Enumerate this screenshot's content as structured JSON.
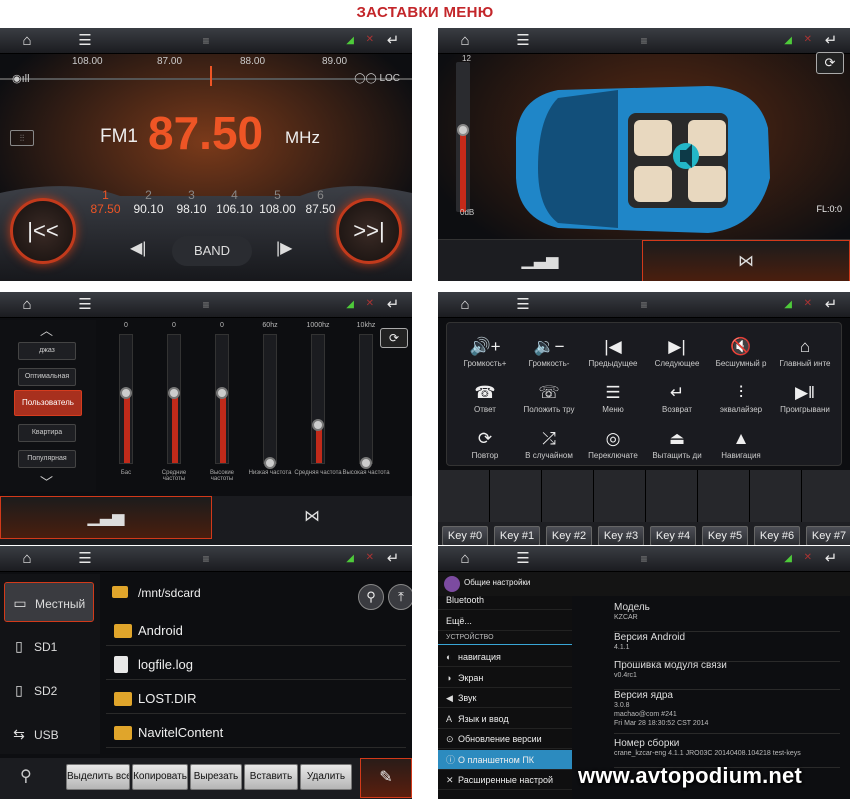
{
  "title": "ЗАСТАВКИ МЕНЮ",
  "watermark": "www.avtopodium.net",
  "colors": {
    "accent": "#ee5525",
    "title": "#c3262a",
    "select": "#2c8bbf"
  },
  "icons": {
    "home": "home-icon",
    "menu": "menu-icon",
    "back": "back-icon",
    "down": "pull-down-icon"
  },
  "radio": {
    "scale": [
      "108.00",
      "87.00",
      "88.00",
      "89.00"
    ],
    "band_label": "FM1",
    "frequency": "87.50",
    "unit": "MHz",
    "loc": "LOC",
    "band_button": "BAND",
    "presets": [
      {
        "n": "1",
        "v": "87.50"
      },
      {
        "n": "2",
        "v": "90.10"
      },
      {
        "n": "3",
        "v": "98.10"
      },
      {
        "n": "4",
        "v": "106.10"
      },
      {
        "n": "5",
        "v": "108.00"
      },
      {
        "n": "6",
        "v": "87.50"
      }
    ]
  },
  "balance": {
    "top": "12",
    "bottom": "0dB",
    "fader": "FL:0:0"
  },
  "eq": {
    "presets": [
      "джаз",
      "Оптимальная",
      "Пользователь",
      "Квартира",
      "Популярная"
    ],
    "columns": [
      {
        "hd": "0",
        "ft": "Бас",
        "level": 0.55
      },
      {
        "hd": "0",
        "ft": "Средние частоты",
        "level": 0.55
      },
      {
        "hd": "0",
        "ft": "Высокие частоты",
        "level": 0.55
      },
      {
        "hd": "60hz",
        "ft": "Низкая частота",
        "level": 0.0
      },
      {
        "hd": "1000hz",
        "ft": "Средняя частота",
        "level": 0.3
      },
      {
        "hd": "10khz",
        "ft": "Высокая частота",
        "level": 0.0
      }
    ]
  },
  "steering": {
    "keys": [
      {
        "ic": "🔊+",
        "lb": "Громкость+"
      },
      {
        "ic": "🔉−",
        "lb": "Громкость-"
      },
      {
        "ic": "|◀",
        "lb": "Предыдущее"
      },
      {
        "ic": "▶|",
        "lb": "Следующее"
      },
      {
        "ic": "🔇",
        "lb": "Бесшумный р"
      },
      {
        "ic": "⌂",
        "lb": "Главный инте"
      },
      {
        "ic": "☎",
        "lb": "Ответ"
      },
      {
        "ic": "☏",
        "lb": "Положить тру"
      },
      {
        "ic": "☰",
        "lb": "Меню"
      },
      {
        "ic": "↵",
        "lb": "Возврат"
      },
      {
        "ic": "⫶",
        "lb": "эквалайзер"
      },
      {
        "ic": "▶‖",
        "lb": "Проигрывани"
      },
      {
        "ic": "⟳",
        "lb": "Повтор"
      },
      {
        "ic": "⤮",
        "lb": "В случайном"
      },
      {
        "ic": "◎",
        "lb": "Переключате"
      },
      {
        "ic": "⏏",
        "lb": "Вытащить ди"
      },
      {
        "ic": "▲",
        "lb": "Навигация"
      }
    ],
    "buttons": [
      "Key #0",
      "Key #1",
      "Key #2",
      "Key #3",
      "Key #4",
      "Key #5",
      "Key #6",
      "Key #7"
    ]
  },
  "files": {
    "side": [
      {
        "ic": "▭",
        "lb": "Местный"
      },
      {
        "ic": "▯",
        "lb": "SD1"
      },
      {
        "ic": "▯",
        "lb": "SD2"
      },
      {
        "ic": "⇆",
        "lb": "USB"
      }
    ],
    "path": "/mnt/sdcard",
    "rows": [
      {
        "t": "folder",
        "n": "Android"
      },
      {
        "t": "doc",
        "n": "logfile.log"
      },
      {
        "t": "folder",
        "n": "LOST.DIR"
      },
      {
        "t": "folder",
        "n": "NavitelContent"
      }
    ],
    "actions": [
      "Выделить все",
      "Копировать",
      "Вырезать",
      "Вставить",
      "Удалить"
    ]
  },
  "settings": {
    "header": "Общие настройки",
    "list": [
      {
        "lb": "Bluetooth",
        "ic": "",
        "type": "row"
      },
      {
        "lb": "Ещё...",
        "ic": "",
        "type": "row"
      },
      {
        "lb": "УСТРОЙСТВО",
        "ic": "",
        "type": "sec"
      },
      {
        "lb": "навигация",
        "ic": "◐",
        "type": "row"
      },
      {
        "lb": "Экран",
        "ic": "◑",
        "type": "row"
      },
      {
        "lb": "Звук",
        "ic": "◀",
        "type": "row"
      },
      {
        "lb": "Язык и ввод",
        "ic": "A",
        "type": "row"
      },
      {
        "lb": "Обновление версии",
        "ic": "⊙",
        "type": "row"
      },
      {
        "lb": "О планшетном ПК",
        "ic": "ⓘ",
        "type": "act"
      },
      {
        "lb": "Расширенные настрой",
        "ic": "✕",
        "type": "row"
      }
    ],
    "detail": [
      {
        "k": "Модель",
        "v": "KZCAR"
      },
      {
        "k": "Версия Android",
        "v": "4.1.1"
      },
      {
        "k": "Прошивка модуля связи",
        "v": "v0.4rc1"
      },
      {
        "k": "Версия ядра",
        "v": "3.0.8\nmachao@com #241\nFri Mar 28 18:30:52 CST 2014"
      },
      {
        "k": "Номер сборки",
        "v": "crane_kzcar-eng 4.1.1 JRO03C 20140408.104218 test-keys"
      }
    ]
  }
}
